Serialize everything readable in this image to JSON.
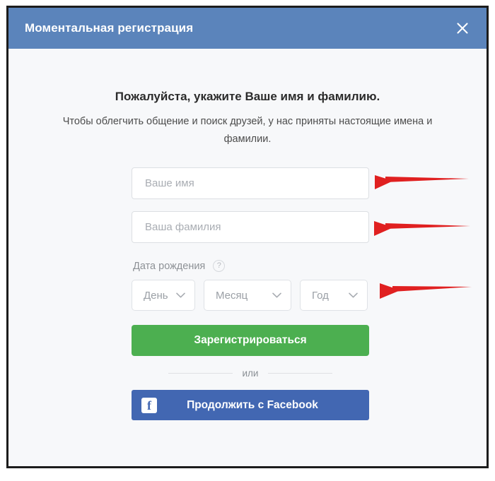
{
  "dialog": {
    "title": "Моментальная регистрация",
    "close_icon": "close-icon"
  },
  "content": {
    "headline": "Пожалуйста, укажите Ваше имя и фамилию.",
    "subtext": "Чтобы облегчить общение и поиск друзей, у нас приняты настоящие имена и фамилии."
  },
  "form": {
    "first_name": {
      "placeholder": "Ваше имя",
      "value": ""
    },
    "last_name": {
      "placeholder": "Ваша фамилия",
      "value": ""
    },
    "birth_date": {
      "label": "Дата рождения",
      "help_icon": "question-mark-icon",
      "day": "День",
      "month": "Месяц",
      "year": "Год",
      "chevron_icon": "chevron-down-icon"
    },
    "register_button": "Зарегистрироваться",
    "divider_text": "или",
    "facebook_button": "Продолжить с Facebook",
    "facebook_icon": "facebook-f-icon"
  },
  "annotations": {
    "arrow_icon": "arrow-left-icon",
    "arrow_color": "#e02020",
    "arrows": [
      {
        "label": "arrow-to-first-name-field"
      },
      {
        "label": "arrow-to-last-name-field"
      },
      {
        "label": "arrow-to-birth-date-selects"
      }
    ]
  },
  "colors": {
    "header": "#5b84bb",
    "body_bg": "#f7f8fa",
    "register_green": "#4caf50",
    "facebook_blue": "#4267b2",
    "frame_border": "#1c1c1c"
  }
}
